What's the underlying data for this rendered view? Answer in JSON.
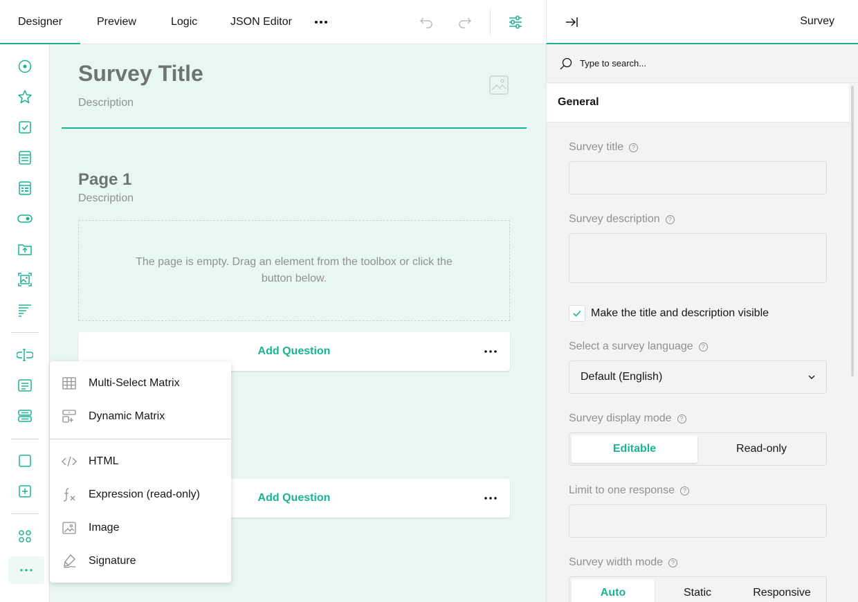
{
  "tabs": [
    "Designer",
    "Preview",
    "Logic",
    "JSON Editor"
  ],
  "right_header": {
    "title": "Survey"
  },
  "canvas": {
    "survey_title": "Survey Title",
    "survey_description": "Description",
    "page_title": "Page 1",
    "page_description": "Description",
    "empty_message": "The page is empty. Drag an element from the toolbox or click the button below.",
    "add_question": "Add Question"
  },
  "popup_items": [
    {
      "label": "Multi-Select Matrix",
      "icon": "matrix-grid-icon"
    },
    {
      "label": "Dynamic Matrix",
      "icon": "dynamic-matrix-icon"
    },
    {
      "label": "HTML",
      "icon": "code-icon"
    },
    {
      "label": "Expression (read-only)",
      "icon": "function-icon"
    },
    {
      "label": "Image",
      "icon": "image-icon"
    },
    {
      "label": "Signature",
      "icon": "signature-pen-icon"
    }
  ],
  "panel": {
    "search_placeholder": "Type to search...",
    "section": "General",
    "survey_title_label": "Survey title",
    "survey_description_label": "Survey description",
    "visible_checkbox_label": "Make the title and description visible",
    "visible_checked": true,
    "language_label": "Select a survey language",
    "language_value": "Default (English)",
    "display_mode_label": "Survey display mode",
    "display_mode_options": [
      "Editable",
      "Read-only"
    ],
    "display_mode_selected": "Editable",
    "limit_label": "Limit to one response",
    "width_mode_label": "Survey width mode",
    "width_mode_options": [
      "Auto",
      "Static",
      "Responsive"
    ],
    "width_mode_selected": "Auto"
  },
  "colors": {
    "accent": "#19b394",
    "canvas_bg": "#e9f7f3",
    "panel_bg": "#f3f3f3"
  }
}
